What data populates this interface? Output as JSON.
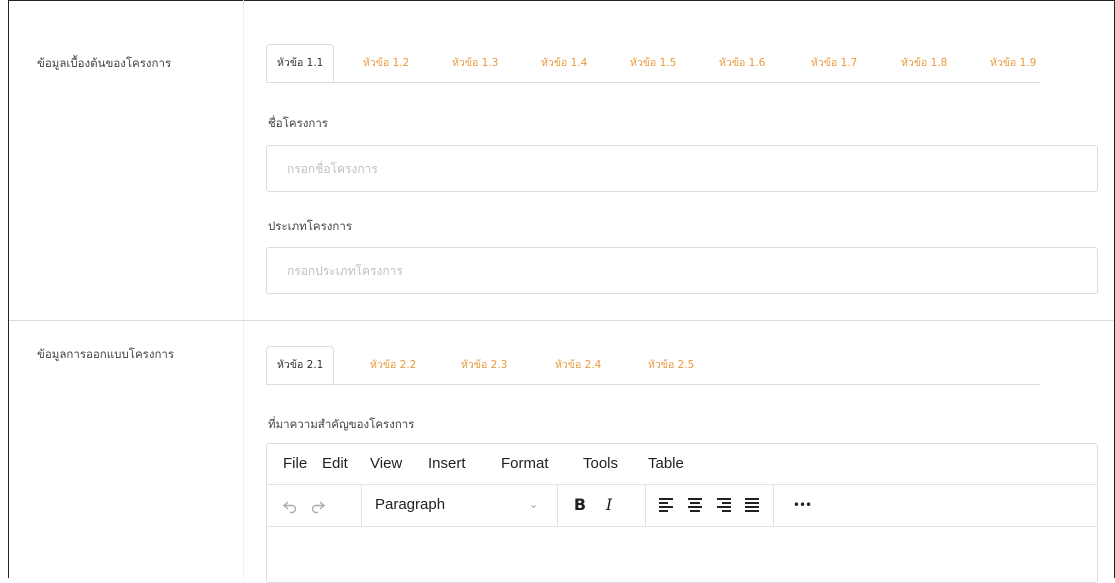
{
  "section1": {
    "label": "ข้อมูลเบื้องต้นของโครงการ",
    "tabs": [
      "หัวข้อ 1.1",
      "หัวข้อ 1.2",
      "หัวข้อ 1.3",
      "หัวข้อ 1.4",
      "หัวข้อ 1.5",
      "หัวข้อ 1.6",
      "หัวข้อ 1.7",
      "หัวข้อ 1.8",
      "หัวข้อ 1.9"
    ],
    "active_tab": "หัวข้อ 1.1",
    "fields": [
      {
        "label": "ชื่อโครงการ",
        "placeholder": "กรอกชื่อโครงการ",
        "value": ""
      },
      {
        "label": "ประเภทโครงการ",
        "placeholder": "กรอกประเภทโครงการ",
        "value": ""
      }
    ]
  },
  "section2": {
    "label": "ข้อมูลการออกแบบโครงการ",
    "tabs": [
      "หัวข้อ 2.1",
      "หัวข้อ 2.2",
      "หัวข้อ 2.3",
      "หัวข้อ 2.4",
      "หัวข้อ 2.5"
    ],
    "active_tab": "หัวข้อ 2.1",
    "editor_label": "ที่มาความสำคัญของโครงการ"
  },
  "editor": {
    "menu": [
      "File",
      "Edit",
      "View",
      "Insert",
      "Format",
      "Tools",
      "Table"
    ],
    "toolbar": {
      "undo_icon": "undo-icon",
      "redo_icon": "redo-icon",
      "format_value": "Paragraph",
      "bold": "B",
      "italic": "I",
      "more": "•••"
    }
  },
  "colors": {
    "tab_link": "#e89a3c",
    "border": "#dcdcdc",
    "text": "#333333"
  }
}
